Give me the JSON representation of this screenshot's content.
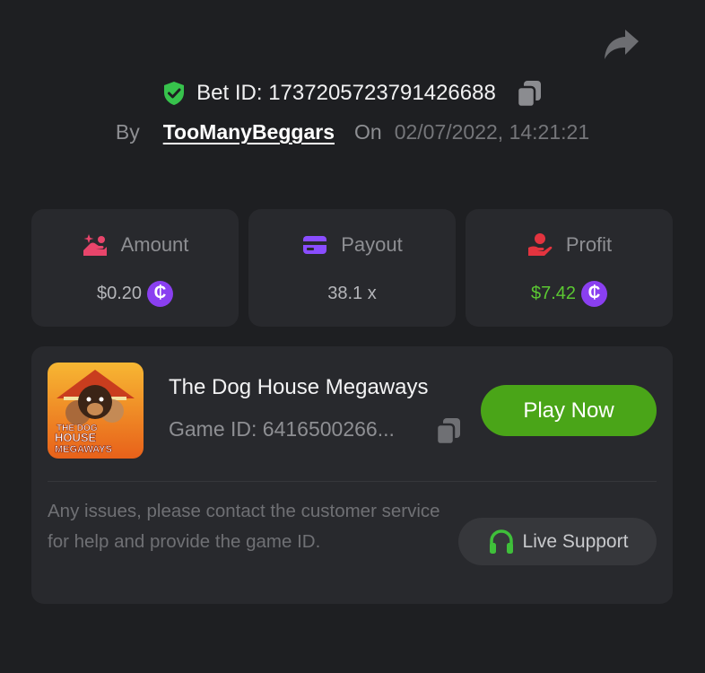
{
  "bet": {
    "id_text": "Bet ID: 1737205723791426688",
    "by_label": "By",
    "username": "TooManyBeggars",
    "on_label": "On",
    "datetime": "02/07/2022, 14:21:21"
  },
  "stats": {
    "amount": {
      "label": "Amount",
      "value": "$0.20",
      "coin": "₵"
    },
    "payout": {
      "label": "Payout",
      "value": "38.1 x"
    },
    "profit": {
      "label": "Profit",
      "value": "$7.42",
      "coin": "₵"
    }
  },
  "game": {
    "title": "The Dog House Megaways",
    "id_text": "Game ID: 6416500266...",
    "thumb_line1": "THE DOG",
    "thumb_line2": "HOUSE",
    "thumb_line3": "MEGAWAYS",
    "play_label": "Play Now"
  },
  "support": {
    "message": "Any issues, please contact the customer service for help and provide the game ID.",
    "button_label": "Live Support"
  },
  "colors": {
    "background": "#1e1f22",
    "card": "#28292d",
    "shield": "#37c24c",
    "amount_icon": "#e8456b",
    "payout_icon": "#8a4dff",
    "profit_icon": "#e3343f",
    "profit_text": "#5bc832",
    "coin": "#8a3ff0",
    "play_button": "#4aa518",
    "support_icon": "#3fbf3a"
  },
  "icons": {
    "share": "share-arrow-icon",
    "verified": "shield-check-icon",
    "copy": "copy-icon",
    "amount": "hand-coins-icon",
    "payout": "card-icon",
    "profit": "hand-profit-icon",
    "headset": "headset-icon"
  }
}
